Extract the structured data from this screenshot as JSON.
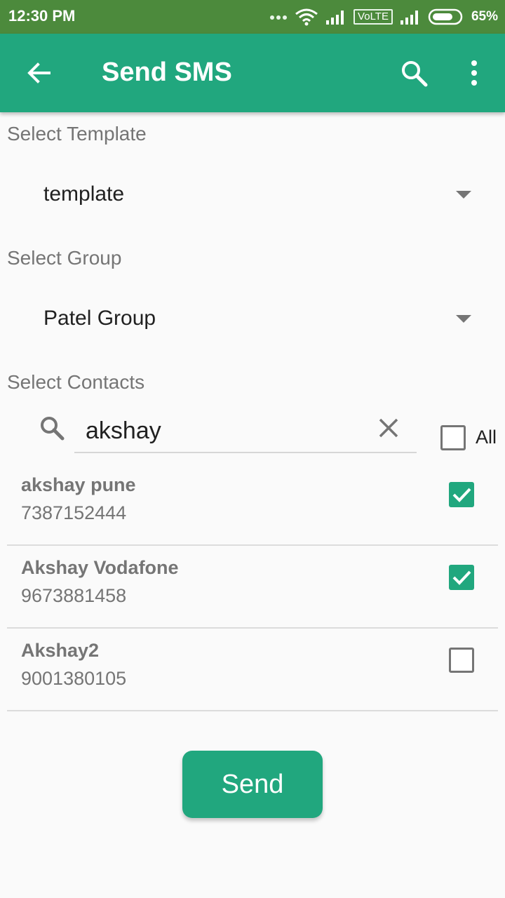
{
  "status_bar": {
    "time": "12:30 PM",
    "network_label": "VoLTE",
    "battery_percent": "65%",
    "icons": [
      "dots-icon",
      "wifi-icon",
      "signal-icon",
      "volte-icon",
      "signal-icon",
      "battery-icon"
    ]
  },
  "app_bar": {
    "title": "Send SMS",
    "color": "#21a77e",
    "icons": [
      "back-arrow-icon",
      "search-icon",
      "more-vert-icon"
    ]
  },
  "template_section": {
    "label": "Select Template",
    "selected": "template"
  },
  "group_section": {
    "label": "Select Group",
    "selected": "Patel Group"
  },
  "contacts_section": {
    "label": "Select Contacts",
    "search_value": "akshay",
    "all_label": "All",
    "all_checked": false
  },
  "contacts": [
    {
      "name": "akshay pune",
      "phone": "7387152444",
      "checked": true
    },
    {
      "name": "Akshay Vodafone",
      "phone": "9673881458",
      "checked": true
    },
    {
      "name": "Akshay2",
      "phone": "9001380105",
      "checked": false
    }
  ],
  "send_button": {
    "label": "Send"
  }
}
